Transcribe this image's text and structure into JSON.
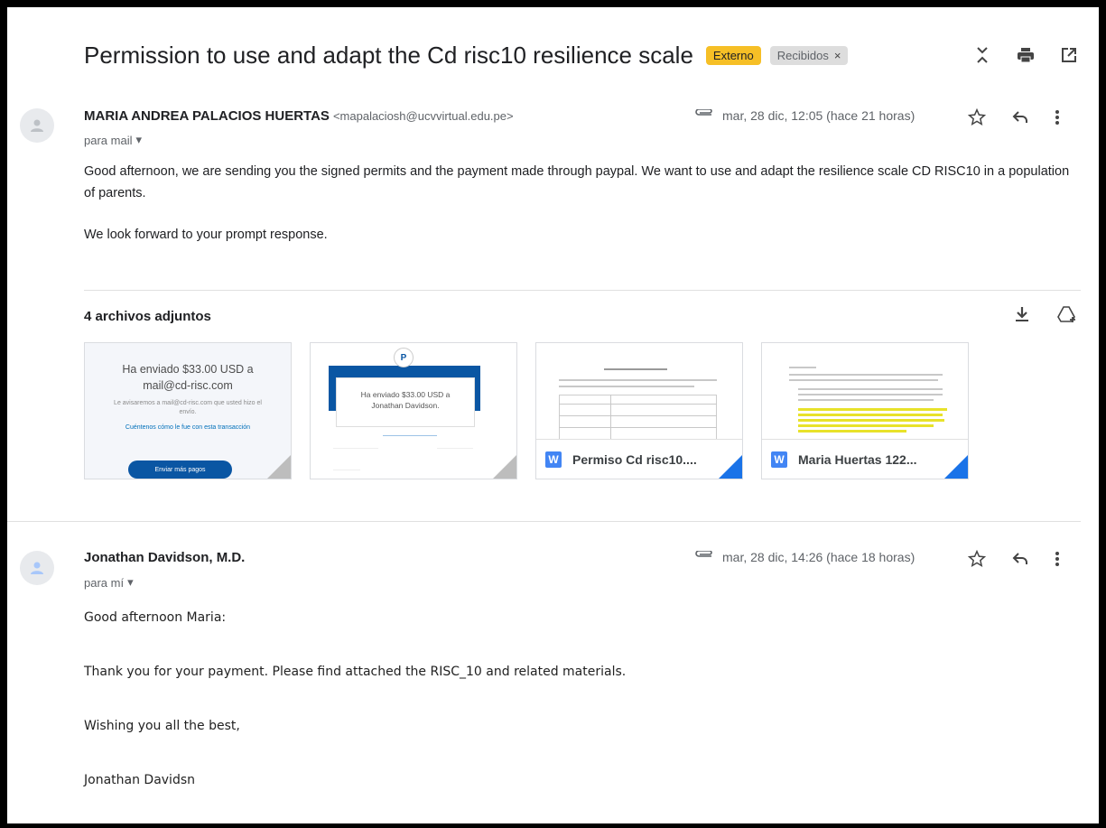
{
  "subject": "Permission to use and adapt the Cd risc10 resilience scale",
  "labels": {
    "external": "Externo",
    "inbox": "Recibidos",
    "inbox_remove": "×"
  },
  "message1": {
    "sender_name": "MARIA ANDREA PALACIOS HUERTAS",
    "sender_email": "<mapalaciosh@ucvvirtual.edu.pe>",
    "to": "para mail",
    "date": "mar, 28 dic, 12:05 (hace 21 horas)",
    "paragraph1": "Good afternoon, we are sending you the signed permits and the payment made through paypal. We want to use and adapt the resilience scale CD RISC10 in a population of parents.",
    "paragraph2": "We look forward to your prompt response."
  },
  "attachments": {
    "title": "4 archivos adjuntos",
    "items": [
      {
        "line1": "Ha enviado $33.00 USD a",
        "line2": "mail@cd-risc.com",
        "small": "Le avisaremos a mail@cd-risc.com que usted hizo el envío.",
        "link": "Cuéntenos cómo le fue con esta transacción",
        "button": "Enviar más pagos"
      },
      {
        "card_text": "Ha enviado $33.00 USD a Jonathan Davidson."
      },
      {
        "name": "Permiso Cd risc10...."
      },
      {
        "name": "Maria Huertas 122..."
      }
    ]
  },
  "message2": {
    "sender_name": "Jonathan Davidson, M.D.",
    "to": "para mí",
    "date": "mar, 28 dic, 14:26 (hace 18 horas)",
    "line1": "Good afternoon Maria:",
    "line2": "Thank you for your payment. Please find attached the RISC_10 and related materials.",
    "line3": "Wishing you all the best,",
    "line4": "Jonathan Davidsn"
  },
  "icons": {
    "expand": "unfold-icon",
    "print": "print-icon",
    "open_new": "open-in-new-icon",
    "attachment": "paperclip-icon",
    "star": "star-icon",
    "reply": "reply-icon",
    "more": "more-vert-icon",
    "download": "download-icon",
    "drive": "add-to-drive-icon",
    "avatar": "person-icon"
  },
  "colors": {
    "external_badge": "#f6bf26",
    "word_icon": "#4285f4",
    "paypal_blue": "#0a56a3"
  }
}
